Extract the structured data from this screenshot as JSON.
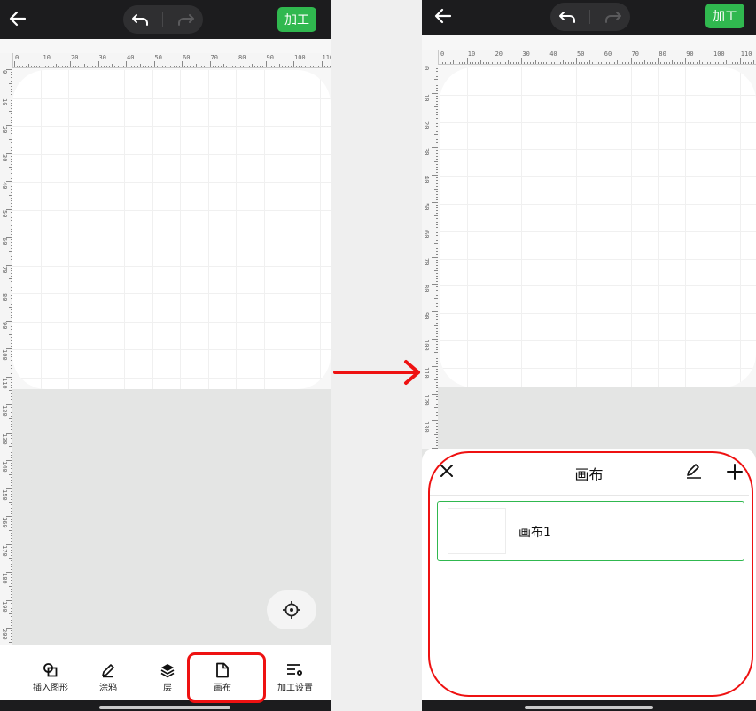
{
  "left_screen": {
    "toolbar": {
      "process_label": "加工"
    },
    "ruler_h": [
      "0",
      "10",
      "20",
      "30",
      "40",
      "50",
      "60",
      "70",
      "80",
      "90",
      "100",
      "110"
    ],
    "ruler_v": [
      "0",
      "10",
      "20",
      "30",
      "40",
      "50",
      "60",
      "70",
      "80",
      "90",
      "100",
      "110",
      "120",
      "130",
      "140",
      "150",
      "160",
      "170",
      "180",
      "190",
      "200",
      "210",
      "220"
    ],
    "tools": [
      {
        "label": "插入图形",
        "icon": "insert-shape-icon"
      },
      {
        "label": "涂鸦",
        "icon": "pen-icon"
      },
      {
        "label": "层",
        "icon": "layers-icon"
      },
      {
        "label": "画布",
        "icon": "document-icon"
      },
      {
        "label": "加工设置",
        "icon": "process-settings-icon"
      }
    ]
  },
  "right_screen": {
    "toolbar": {
      "process_label": "加工"
    },
    "ruler_h": [
      "0",
      "10",
      "20",
      "30",
      "40",
      "50",
      "60",
      "70",
      "80",
      "90",
      "100",
      "110"
    ],
    "ruler_v": [
      "0",
      "10",
      "20",
      "30",
      "40",
      "50",
      "60",
      "70",
      "80",
      "90",
      "100",
      "110",
      "120",
      "130"
    ],
    "canvas_panel": {
      "title": "画布",
      "items": [
        {
          "name": "画布1"
        }
      ]
    }
  },
  "annotation": {
    "highlight_color": "#ee1111",
    "accent_color": "#30b84f"
  }
}
